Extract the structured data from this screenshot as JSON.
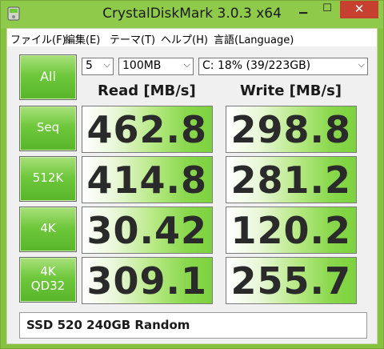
{
  "window": {
    "title": "CrystalDiskMark 3.0.3 x64"
  },
  "menu": [
    "ファイル(F)",
    "編集(E)",
    "テーマ(T)",
    "ヘルプ(H)",
    "言語(Language)"
  ],
  "controls": {
    "all_label": "All",
    "count_value": "5",
    "size_value": "100MB",
    "drive_value": "C: 18% (39/223GB)"
  },
  "headers": {
    "read": "Read [MB/s]",
    "write": "Write [MB/s]"
  },
  "rows": [
    {
      "label": "Seq",
      "read": "462.8",
      "write": "298.8"
    },
    {
      "label": "512K",
      "read": "414.8",
      "write": "281.2"
    },
    {
      "label": "4K",
      "read": "30.42",
      "write": "120.2"
    },
    {
      "label": "4K",
      "label2": "QD32",
      "read": "309.1",
      "write": "255.7"
    }
  ],
  "comment": "SSD 520 240GB Random",
  "colors": {
    "frame": "#86c140",
    "button": "#6fc83c",
    "close": "#c7402f"
  }
}
